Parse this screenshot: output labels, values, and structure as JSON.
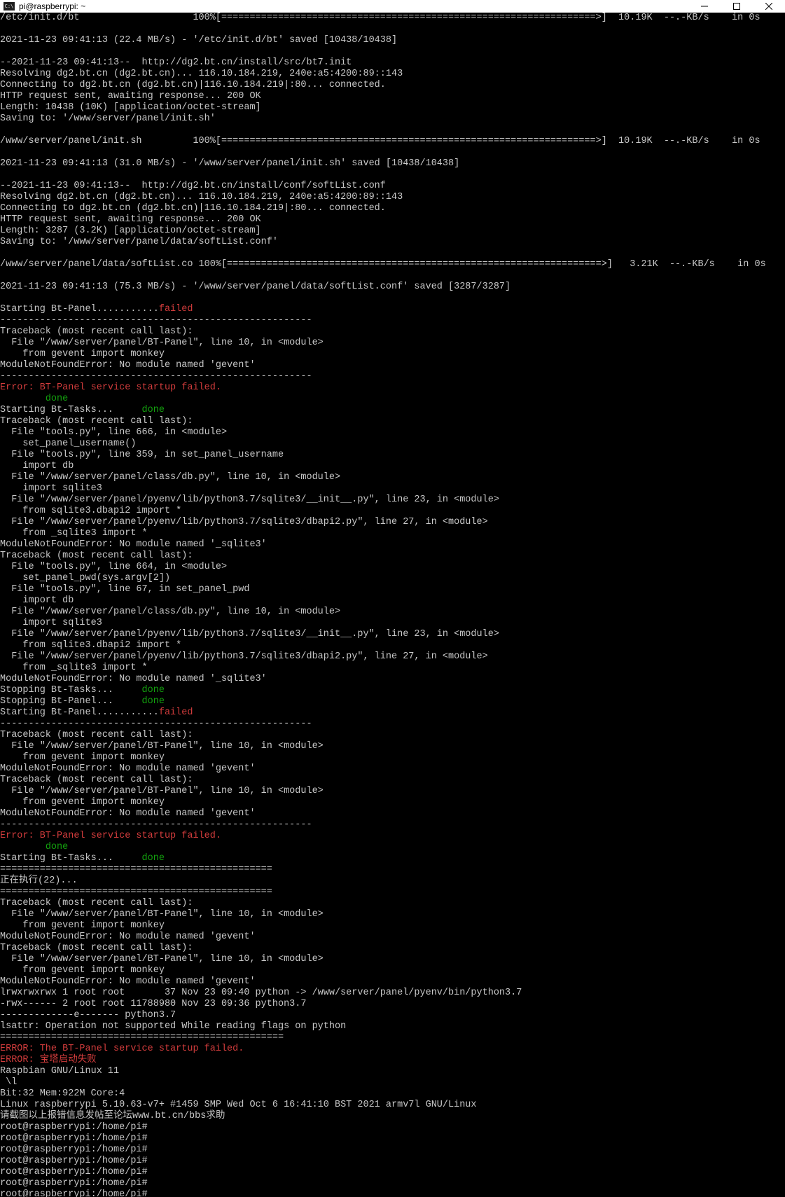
{
  "window": {
    "title": "pi@raspberrypi: ~",
    "icon_label": "C:\\",
    "controls": [
      "minimize",
      "maximize",
      "close"
    ]
  },
  "colors": {
    "background": "#000000",
    "text": "#c8c8c8",
    "error": "#d23c3c",
    "ok": "#13a10e"
  },
  "lines": [
    {
      "segments": [
        {
          "t": "/etc/init.d/bt                    100%[==================================================================>]  10.19K  --.-KB/s    in 0s"
        }
      ]
    },
    {
      "segments": [
        {
          "t": ""
        }
      ]
    },
    {
      "segments": [
        {
          "t": "2021-11-23 09:41:13 (22.4 MB/s) - '/etc/init.d/bt' saved [10438/10438]"
        }
      ]
    },
    {
      "segments": [
        {
          "t": ""
        }
      ]
    },
    {
      "segments": [
        {
          "t": "--2021-11-23 09:41:13--  http://dg2.bt.cn/install/src/bt7.init"
        }
      ]
    },
    {
      "segments": [
        {
          "t": "Resolving dg2.bt.cn (dg2.bt.cn)... 116.10.184.219, 240e:a5:4200:89::143"
        }
      ]
    },
    {
      "segments": [
        {
          "t": "Connecting to dg2.bt.cn (dg2.bt.cn)|116.10.184.219|:80... connected."
        }
      ]
    },
    {
      "segments": [
        {
          "t": "HTTP request sent, awaiting response... 200 OK"
        }
      ]
    },
    {
      "segments": [
        {
          "t": "Length: 10438 (10K) [application/octet-stream]"
        }
      ]
    },
    {
      "segments": [
        {
          "t": "Saving to: '/www/server/panel/init.sh'"
        }
      ]
    },
    {
      "segments": [
        {
          "t": ""
        }
      ]
    },
    {
      "segments": [
        {
          "t": "/www/server/panel/init.sh         100%[==================================================================>]  10.19K  --.-KB/s    in 0s"
        }
      ]
    },
    {
      "segments": [
        {
          "t": ""
        }
      ]
    },
    {
      "segments": [
        {
          "t": "2021-11-23 09:41:13 (31.0 MB/s) - '/www/server/panel/init.sh' saved [10438/10438]"
        }
      ]
    },
    {
      "segments": [
        {
          "t": ""
        }
      ]
    },
    {
      "segments": [
        {
          "t": "--2021-11-23 09:41:13--  http://dg2.bt.cn/install/conf/softList.conf"
        }
      ]
    },
    {
      "segments": [
        {
          "t": "Resolving dg2.bt.cn (dg2.bt.cn)... 116.10.184.219, 240e:a5:4200:89::143"
        }
      ]
    },
    {
      "segments": [
        {
          "t": "Connecting to dg2.bt.cn (dg2.bt.cn)|116.10.184.219|:80... connected."
        }
      ]
    },
    {
      "segments": [
        {
          "t": "HTTP request sent, awaiting response... 200 OK"
        }
      ]
    },
    {
      "segments": [
        {
          "t": "Length: 3287 (3.2K) [application/octet-stream]"
        }
      ]
    },
    {
      "segments": [
        {
          "t": "Saving to: '/www/server/panel/data/softList.conf'"
        }
      ]
    },
    {
      "segments": [
        {
          "t": ""
        }
      ]
    },
    {
      "segments": [
        {
          "t": "/www/server/panel/data/softList.co 100%[==================================================================>]   3.21K  --.-KB/s    in 0s"
        }
      ]
    },
    {
      "segments": [
        {
          "t": ""
        }
      ]
    },
    {
      "segments": [
        {
          "t": "2021-11-23 09:41:13 (75.3 MB/s) - '/www/server/panel/data/softList.conf' saved [3287/3287]"
        }
      ]
    },
    {
      "segments": [
        {
          "t": ""
        }
      ]
    },
    {
      "segments": [
        {
          "t": "Starting Bt-Panel..........."
        },
        {
          "t": "failed",
          "c": "red"
        }
      ]
    },
    {
      "segments": [
        {
          "t": "-------------------------------------------------------"
        }
      ]
    },
    {
      "segments": [
        {
          "t": "Traceback (most recent call last):"
        }
      ]
    },
    {
      "segments": [
        {
          "t": "  File \"/www/server/panel/BT-Panel\", line 10, in <module>"
        }
      ]
    },
    {
      "segments": [
        {
          "t": "    from gevent import monkey"
        }
      ]
    },
    {
      "segments": [
        {
          "t": "ModuleNotFoundError: No module named 'gevent'"
        }
      ]
    },
    {
      "segments": [
        {
          "t": "-------------------------------------------------------"
        }
      ]
    },
    {
      "segments": [
        {
          "t": "Error: BT-Panel service startup failed.",
          "c": "red"
        }
      ]
    },
    {
      "segments": [
        {
          "t": "        "
        },
        {
          "t": "done",
          "c": "green"
        }
      ]
    },
    {
      "segments": [
        {
          "t": "Starting Bt-Tasks...     "
        },
        {
          "t": "done",
          "c": "green"
        }
      ]
    },
    {
      "segments": [
        {
          "t": "Traceback (most recent call last):"
        }
      ]
    },
    {
      "segments": [
        {
          "t": "  File \"tools.py\", line 666, in <module>"
        }
      ]
    },
    {
      "segments": [
        {
          "t": "    set_panel_username()"
        }
      ]
    },
    {
      "segments": [
        {
          "t": "  File \"tools.py\", line 359, in set_panel_username"
        }
      ]
    },
    {
      "segments": [
        {
          "t": "    import db"
        }
      ]
    },
    {
      "segments": [
        {
          "t": "  File \"/www/server/panel/class/db.py\", line 10, in <module>"
        }
      ]
    },
    {
      "segments": [
        {
          "t": "    import sqlite3"
        }
      ]
    },
    {
      "segments": [
        {
          "t": "  File \"/www/server/panel/pyenv/lib/python3.7/sqlite3/__init__.py\", line 23, in <module>"
        }
      ]
    },
    {
      "segments": [
        {
          "t": "    from sqlite3.dbapi2 import *"
        }
      ]
    },
    {
      "segments": [
        {
          "t": "  File \"/www/server/panel/pyenv/lib/python3.7/sqlite3/dbapi2.py\", line 27, in <module>"
        }
      ]
    },
    {
      "segments": [
        {
          "t": "    from _sqlite3 import *"
        }
      ]
    },
    {
      "segments": [
        {
          "t": "ModuleNotFoundError: No module named '_sqlite3'"
        }
      ]
    },
    {
      "segments": [
        {
          "t": "Traceback (most recent call last):"
        }
      ]
    },
    {
      "segments": [
        {
          "t": "  File \"tools.py\", line 664, in <module>"
        }
      ]
    },
    {
      "segments": [
        {
          "t": "    set_panel_pwd(sys.argv[2])"
        }
      ]
    },
    {
      "segments": [
        {
          "t": "  File \"tools.py\", line 67, in set_panel_pwd"
        }
      ]
    },
    {
      "segments": [
        {
          "t": "    import db"
        }
      ]
    },
    {
      "segments": [
        {
          "t": "  File \"/www/server/panel/class/db.py\", line 10, in <module>"
        }
      ]
    },
    {
      "segments": [
        {
          "t": "    import sqlite3"
        }
      ]
    },
    {
      "segments": [
        {
          "t": "  File \"/www/server/panel/pyenv/lib/python3.7/sqlite3/__init__.py\", line 23, in <module>"
        }
      ]
    },
    {
      "segments": [
        {
          "t": "    from sqlite3.dbapi2 import *"
        }
      ]
    },
    {
      "segments": [
        {
          "t": "  File \"/www/server/panel/pyenv/lib/python3.7/sqlite3/dbapi2.py\", line 27, in <module>"
        }
      ]
    },
    {
      "segments": [
        {
          "t": "    from _sqlite3 import *"
        }
      ]
    },
    {
      "segments": [
        {
          "t": "ModuleNotFoundError: No module named '_sqlite3'"
        }
      ]
    },
    {
      "segments": [
        {
          "t": "Stopping Bt-Tasks...     "
        },
        {
          "t": "done",
          "c": "green"
        }
      ]
    },
    {
      "segments": [
        {
          "t": "Stopping Bt-Panel...     "
        },
        {
          "t": "done",
          "c": "green"
        }
      ]
    },
    {
      "segments": [
        {
          "t": "Starting Bt-Panel..........."
        },
        {
          "t": "failed",
          "c": "red"
        }
      ]
    },
    {
      "segments": [
        {
          "t": "-------------------------------------------------------"
        }
      ]
    },
    {
      "segments": [
        {
          "t": "Traceback (most recent call last):"
        }
      ]
    },
    {
      "segments": [
        {
          "t": "  File \"/www/server/panel/BT-Panel\", line 10, in <module>"
        }
      ]
    },
    {
      "segments": [
        {
          "t": "    from gevent import monkey"
        }
      ]
    },
    {
      "segments": [
        {
          "t": "ModuleNotFoundError: No module named 'gevent'"
        }
      ]
    },
    {
      "segments": [
        {
          "t": "Traceback (most recent call last):"
        }
      ]
    },
    {
      "segments": [
        {
          "t": "  File \"/www/server/panel/BT-Panel\", line 10, in <module>"
        }
      ]
    },
    {
      "segments": [
        {
          "t": "    from gevent import monkey"
        }
      ]
    },
    {
      "segments": [
        {
          "t": "ModuleNotFoundError: No module named 'gevent'"
        }
      ]
    },
    {
      "segments": [
        {
          "t": "-------------------------------------------------------"
        }
      ]
    },
    {
      "segments": [
        {
          "t": "Error: BT-Panel service startup failed.",
          "c": "red"
        }
      ]
    },
    {
      "segments": [
        {
          "t": "        "
        },
        {
          "t": "done",
          "c": "green"
        }
      ]
    },
    {
      "segments": [
        {
          "t": "Starting Bt-Tasks...     "
        },
        {
          "t": "done",
          "c": "green"
        }
      ]
    },
    {
      "segments": [
        {
          "t": "================================================"
        }
      ]
    },
    {
      "segments": [
        {
          "t": "正在执行(22)..."
        }
      ]
    },
    {
      "segments": [
        {
          "t": "================================================"
        }
      ]
    },
    {
      "segments": [
        {
          "t": "Traceback (most recent call last):"
        }
      ]
    },
    {
      "segments": [
        {
          "t": "  File \"/www/server/panel/BT-Panel\", line 10, in <module>"
        }
      ]
    },
    {
      "segments": [
        {
          "t": "    from gevent import monkey"
        }
      ]
    },
    {
      "segments": [
        {
          "t": "ModuleNotFoundError: No module named 'gevent'"
        }
      ]
    },
    {
      "segments": [
        {
          "t": "Traceback (most recent call last):"
        }
      ]
    },
    {
      "segments": [
        {
          "t": "  File \"/www/server/panel/BT-Panel\", line 10, in <module>"
        }
      ]
    },
    {
      "segments": [
        {
          "t": "    from gevent import monkey"
        }
      ]
    },
    {
      "segments": [
        {
          "t": "ModuleNotFoundError: No module named 'gevent'"
        }
      ]
    },
    {
      "segments": [
        {
          "t": "lrwxrwxrwx 1 root root       37 Nov 23 09:40 python -> /www/server/panel/pyenv/bin/python3.7"
        }
      ]
    },
    {
      "segments": [
        {
          "t": "-rwx------ 2 root root 11788980 Nov 23 09:36 python3.7"
        }
      ]
    },
    {
      "segments": [
        {
          "t": "-------------e------- python3.7"
        }
      ]
    },
    {
      "segments": [
        {
          "t": "lsattr: Operation not supported While reading flags on python"
        }
      ]
    },
    {
      "segments": [
        {
          "t": "=================================================="
        }
      ]
    },
    {
      "segments": [
        {
          "t": "ERROR: The BT-Panel service startup failed.",
          "c": "red"
        }
      ]
    },
    {
      "segments": [
        {
          "t": "ERROR: 宝塔启动失败",
          "c": "red"
        }
      ]
    },
    {
      "segments": [
        {
          "t": "Raspbian GNU/Linux 11"
        }
      ]
    },
    {
      "segments": [
        {
          "t": " \\l"
        }
      ]
    },
    {
      "segments": [
        {
          "t": "Bit:32 Mem:922M Core:4"
        }
      ]
    },
    {
      "segments": [
        {
          "t": "Linux raspberrypi 5.10.63-v7+ #1459 SMP Wed Oct 6 16:41:10 BST 2021 armv7l GNU/Linux"
        }
      ]
    },
    {
      "segments": [
        {
          "t": "请截图以上报错信息发帖至论坛www.bt.cn/bbs求助"
        }
      ]
    },
    {
      "segments": [
        {
          "t": "root@raspberrypi:/home/pi#"
        }
      ]
    },
    {
      "segments": [
        {
          "t": "root@raspberrypi:/home/pi#"
        }
      ]
    },
    {
      "segments": [
        {
          "t": "root@raspberrypi:/home/pi#"
        }
      ]
    },
    {
      "segments": [
        {
          "t": "root@raspberrypi:/home/pi#"
        }
      ]
    },
    {
      "segments": [
        {
          "t": "root@raspberrypi:/home/pi#"
        }
      ]
    },
    {
      "segments": [
        {
          "t": "root@raspberrypi:/home/pi#"
        }
      ]
    },
    {
      "segments": [
        {
          "t": "root@raspberrypi:/home/pi#"
        }
      ]
    }
  ]
}
